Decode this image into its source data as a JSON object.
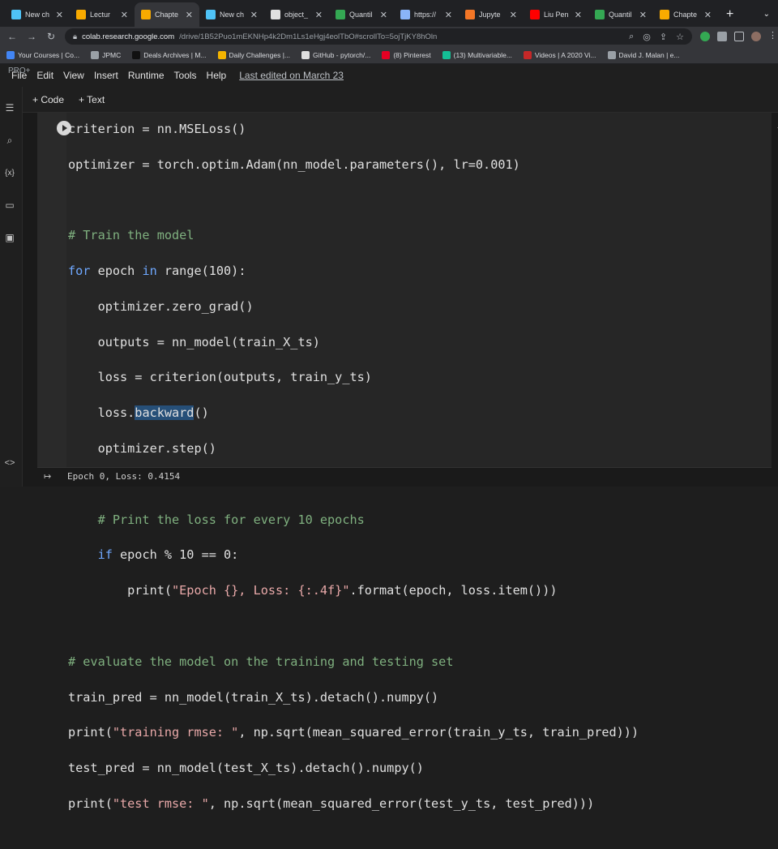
{
  "tabs": [
    {
      "label": "New ch",
      "icon": "colab-doc-icon",
      "color": "#4fc3f7"
    },
    {
      "label": "Lectur",
      "icon": "colab-icon",
      "color": "#f9ab00"
    },
    {
      "label": "Chapte",
      "icon": "colab-icon",
      "color": "#f9ab00",
      "active": true
    },
    {
      "label": "New ch",
      "icon": "colab-doc-icon",
      "color": "#4fc3f7"
    },
    {
      "label": "object_",
      "icon": "github-icon",
      "color": "#e0e0e0"
    },
    {
      "label": "Quantil",
      "icon": "drive-icon",
      "color": "#34a853"
    },
    {
      "label": "https://",
      "icon": "globe-icon",
      "color": "#8ab4f8"
    },
    {
      "label": "Jupyte",
      "icon": "jupyter-icon",
      "color": "#f37626"
    },
    {
      "label": "Liu Pen",
      "icon": "youtube-icon",
      "color": "#ff0000"
    },
    {
      "label": "Quantil",
      "icon": "drive-icon",
      "color": "#34a853"
    },
    {
      "label": "Chapte",
      "icon": "colab-icon",
      "color": "#f9ab00"
    }
  ],
  "address": {
    "host": "colab.research.google.com",
    "path": "/drive/1B52Puo1mEKNHp4k2Dm1Ls1eHgj4eolTbO#scrollTo=5ojTjKY8hOln"
  },
  "bookmarks": [
    {
      "label": "Your Courses | Co...",
      "color": "#4285f4"
    },
    {
      "label": "JPMC",
      "color": "#9aa0a6"
    },
    {
      "label": "Deals Archives | M...",
      "color": "#111111"
    },
    {
      "label": "Daily Challenges |...",
      "color": "#f4b400"
    },
    {
      "label": "GitHub - pytorch/...",
      "color": "#e0e0e0"
    },
    {
      "label": "(8) Pinterest",
      "color": "#e60023"
    },
    {
      "label": "(13) Multivariable...",
      "color": "#14bf96"
    },
    {
      "label": "Videos | A 2020 Vi...",
      "color": "#c62828"
    },
    {
      "label": "David J. Malan | e...",
      "color": "#9aa0a6"
    }
  ],
  "menubar": {
    "pro": "PRO+",
    "items": [
      "File",
      "Edit",
      "View",
      "Insert",
      "Runtime",
      "Tools",
      "Help"
    ],
    "last_edited": "Last edited on March 23"
  },
  "toolbar": {
    "code": "+ Code",
    "text": "+ Text"
  },
  "code": {
    "line0": "criterion = nn.MSELoss()",
    "line1": "optimizer = torch.optim.Adam(nn_model.parameters(), lr=0.001)",
    "comment1": "# Train the model",
    "for_kw": "for",
    "for_rest1": " epoch ",
    "in_kw": "in",
    "for_rest2": " range(100):",
    "l_zero": "    optimizer.zero_grad()",
    "l_outputs": "    outputs = nn_model(train_X_ts)",
    "l_loss": "    loss = criterion(outputs, train_y_ts)",
    "l_back_pre": "    loss.",
    "l_back_sel": "backward",
    "l_back_post": "()",
    "l_step": "    optimizer.step()",
    "comment2": "    # Print the loss for every 10 epochs",
    "if_pre": "    ",
    "if_kw": "if",
    "if_rest": " epoch % 10 == 0:",
    "print_pre": "        print(",
    "print_str": "\"Epoch {}, Loss: {:.4f}\"",
    "print_post": ".format(epoch, loss.item()))",
    "comment3": "# evaluate the model on the training and testing set",
    "l_trainpred": "train_pred = nn_model(train_X_ts).detach().numpy()",
    "p1_pre": "print(",
    "p1_str": "\"training rmse: \"",
    "p1_post": ", np.sqrt(mean_squared_error(train_y_ts, train_pred)))",
    "l_testpred": "test_pred = nn_model(test_X_ts).detach().numpy()",
    "p2_pre": "print(",
    "p2_str": "\"test rmse: \"",
    "p2_post": ", np.sqrt(mean_squared_error(test_y_ts, test_pred)))"
  },
  "output": {
    "text": "Epoch 0, Loss: 0.4154"
  },
  "colors": {
    "keyword": "#6fa8ff",
    "comment": "#7fb07f",
    "string": "#e8a8a8",
    "selection": "#264f78"
  }
}
